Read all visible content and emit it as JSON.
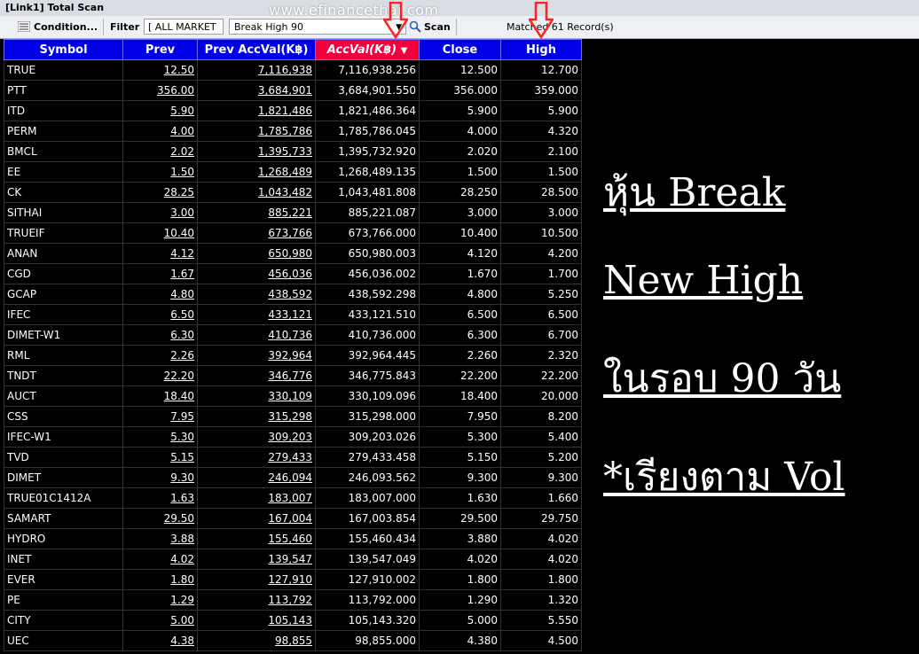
{
  "window": {
    "title": "[Link1] Total Scan"
  },
  "toolbar": {
    "condition_label": "Condition...",
    "filter_label": "Filter :",
    "filter_value": "[ ALL MARKET ]",
    "scan_option": "Break High 90",
    "scan_button": "Scan",
    "matched_text": "Matched 61 Record(s)"
  },
  "watermark": "www.efinancethai.com",
  "table": {
    "columns": [
      "Symbol",
      "Prev",
      "Prev AccVal(K฿)",
      "AccVal(K฿)",
      "Close",
      "High"
    ],
    "rows": [
      [
        "TRUE",
        "12.50",
        "7,116,938",
        "7,116,938.256",
        "12.500",
        "12.700"
      ],
      [
        "PTT",
        "356.00",
        "3,684,901",
        "3,684,901.550",
        "356.000",
        "359.000"
      ],
      [
        "ITD",
        "5.90",
        "1,821,486",
        "1,821,486.364",
        "5.900",
        "5.900"
      ],
      [
        "PERM",
        "4.00",
        "1,785,786",
        "1,785,786.045",
        "4.000",
        "4.320"
      ],
      [
        "BMCL",
        "2.02",
        "1,395,733",
        "1,395,732.920",
        "2.020",
        "2.100"
      ],
      [
        "EE",
        "1.50",
        "1,268,489",
        "1,268,489.135",
        "1.500",
        "1.500"
      ],
      [
        "CK",
        "28.25",
        "1,043,482",
        "1,043,481.808",
        "28.250",
        "28.500"
      ],
      [
        "SITHAI",
        "3.00",
        "885,221",
        "885,221.087",
        "3.000",
        "3.000"
      ],
      [
        "TRUEIF",
        "10.40",
        "673,766",
        "673,766.000",
        "10.400",
        "10.500"
      ],
      [
        "ANAN",
        "4.12",
        "650,980",
        "650,980.003",
        "4.120",
        "4.200"
      ],
      [
        "CGD",
        "1.67",
        "456,036",
        "456,036.002",
        "1.670",
        "1.700"
      ],
      [
        "GCAP",
        "4.80",
        "438,592",
        "438,592.298",
        "4.800",
        "5.250"
      ],
      [
        "IFEC",
        "6.50",
        "433,121",
        "433,121.510",
        "6.500",
        "6.500"
      ],
      [
        "DIMET-W1",
        "6.30",
        "410,736",
        "410,736.000",
        "6.300",
        "6.700"
      ],
      [
        "RML",
        "2.26",
        "392,964",
        "392,964.445",
        "2.260",
        "2.320"
      ],
      [
        "TNDT",
        "22.20",
        "346,776",
        "346,775.843",
        "22.200",
        "22.200"
      ],
      [
        "AUCT",
        "18.40",
        "330,109",
        "330,109.096",
        "18.400",
        "20.000"
      ],
      [
        "CSS",
        "7.95",
        "315,298",
        "315,298.000",
        "7.950",
        "8.200"
      ],
      [
        "IFEC-W1",
        "5.30",
        "309,203",
        "309,203.026",
        "5.300",
        "5.400"
      ],
      [
        "TVD",
        "5.15",
        "279,433",
        "279,433.458",
        "5.150",
        "5.200"
      ],
      [
        "DIMET",
        "9.30",
        "246,094",
        "246,093.562",
        "9.300",
        "9.300"
      ],
      [
        "TRUE01C1412A",
        "1.63",
        "183,007",
        "183,007.000",
        "1.630",
        "1.660"
      ],
      [
        "SAMART",
        "29.50",
        "167,004",
        "167,003.854",
        "29.500",
        "29.750"
      ],
      [
        "HYDRO",
        "3.88",
        "155,460",
        "155,460.434",
        "3.880",
        "4.020"
      ],
      [
        "INET",
        "4.02",
        "139,547",
        "139,547.049",
        "4.020",
        "4.020"
      ],
      [
        "EVER",
        "1.80",
        "127,910",
        "127,910.002",
        "1.800",
        "1.800"
      ],
      [
        "PE",
        "1.29",
        "113,792",
        "113,792.000",
        "1.290",
        "1.320"
      ],
      [
        "CITY",
        "5.00",
        "105,143",
        "105,143.320",
        "5.000",
        "5.550"
      ],
      [
        "UEC",
        "4.38",
        "98,855",
        "98,855.000",
        "4.380",
        "4.500"
      ]
    ]
  },
  "overlay": {
    "line1": "หุ้น Break",
    "line2": "New High",
    "line3": "ในรอบ 90 วัน",
    "line4": "*เรียงตาม Vol"
  },
  "colors": {
    "header_bg": "#0000e6",
    "sorted_header_bg": "#f0003c",
    "symbol_text": "#ffff00",
    "annotation_arrow": "#ff2020"
  }
}
